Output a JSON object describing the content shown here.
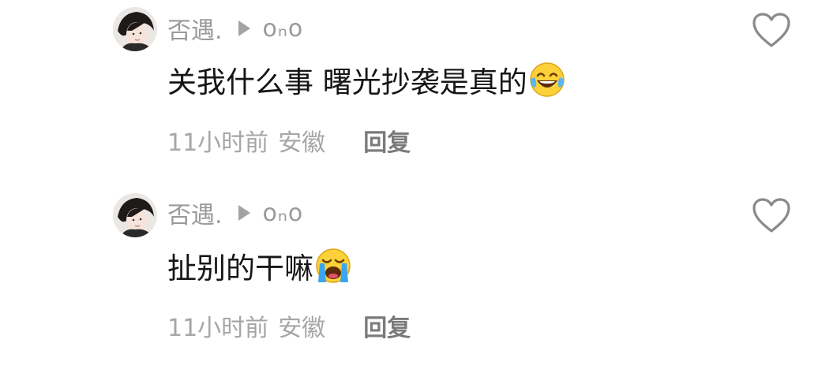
{
  "comments": [
    {
      "username": "否遇.",
      "reply_to": "oₙo",
      "text": "关我什么事 曙光抄袭是真的",
      "emoji": "face-with-tears-of-joy",
      "time": "11小时前",
      "location": "安徽",
      "reply_label": "回复"
    },
    {
      "username": "否遇.",
      "reply_to": "oₙo",
      "text": "扯别的干嘛",
      "emoji": "loudly-crying-face",
      "time": "11小时前",
      "location": "安徽",
      "reply_label": "回复"
    }
  ],
  "colors": {
    "muted_text": "#9a9a9a",
    "body_text": "#161616",
    "reply_button": "#7a7a7a",
    "heart_outline": "#8a8a8a"
  }
}
